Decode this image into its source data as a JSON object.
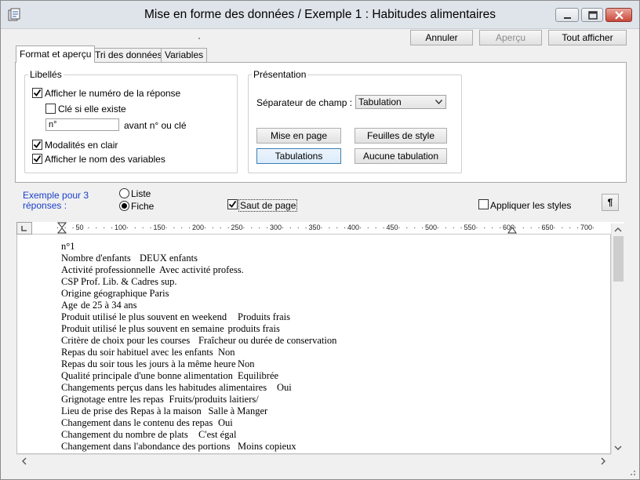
{
  "window": {
    "title": "Mise en forme des données / Exemple 1 : Habitudes alimentaires"
  },
  "actions": {
    "cancel_label": "Annuler",
    "preview_label": "Aperçu",
    "show_all_label": "Tout afficher"
  },
  "tabs": [
    {
      "label": "Format et aperçu",
      "active": true
    },
    {
      "label": "Tri des données",
      "active": false
    },
    {
      "label": "Variables",
      "active": false
    }
  ],
  "labels_group": {
    "title": "Libellés",
    "show_response_number": {
      "label": "Afficher le numéro de la réponse",
      "checked": true
    },
    "key_if_exists": {
      "label": "Clé si elle existe",
      "checked": false
    },
    "prefix_value": "n°",
    "prefix_caption": "avant n° ou clé",
    "clear_modalities": {
      "label": "Modalités en clair",
      "checked": true
    },
    "show_variable_names": {
      "label": "Afficher le nom des variables",
      "checked": true
    }
  },
  "presentation_group": {
    "title": "Présentation",
    "separator_label": "Séparateur de champ :",
    "separator_value": "Tabulation",
    "page_setup_label": "Mise en page",
    "stylesheets_label": "Feuilles de style",
    "tabs_label": "Tabulations",
    "no_tabs_label": "Aucune tabulation"
  },
  "example": {
    "caption_line1": "Exemple pour 3",
    "caption_line2": "réponses :",
    "list_label": "Liste",
    "sheet_label": "Fiche",
    "selected": "Fiche",
    "page_break": {
      "label": "Saut de page",
      "checked": true
    },
    "apply_styles": {
      "label": "Appliquer les styles",
      "checked": false
    },
    "paragraph_mark": "¶"
  },
  "ruler": {
    "ticks": [
      "50",
      "100",
      "150",
      "200",
      "250",
      "300",
      "350",
      "400",
      "450",
      "500",
      "550",
      "600",
      "650",
      "700"
    ]
  },
  "document": {
    "lines": [
      "n°1",
      "Nombre d'enfants\tDEUX enfants",
      "Activité professionnelle\tAvec activité profess.",
      "CSP\tProf. Lib. & Cadres sup.",
      "Origine géographique\tParis",
      "Age\tde 25 à 34 ans",
      "Produit utilisé le plus souvent en weekend\tProduits frais",
      "Produit utilisé le plus souvent en semaine\tproduits frais",
      "Critère de choix pour les courses\tFraîcheur ou durée de conservation",
      "Repas du soir habituel avec les enfants\tNon",
      "Repas du soir tous les jours à la même heure\tNon",
      "Qualité principale d'une bonne alimentation\tEquilibrée",
      "Changements perçus dans les habitudes alimentaires\tOui",
      "Grignotage entre les repas\tFruits/produits laitiers/",
      "Lieu de prise des Repas à la maison\tSalle à Manger",
      "Changement dans le contenu des repas\tOui",
      "Changement du nombre de plats\tC'est égal",
      "Changement dans l'abondance des portions\tMoins copieux"
    ]
  }
}
